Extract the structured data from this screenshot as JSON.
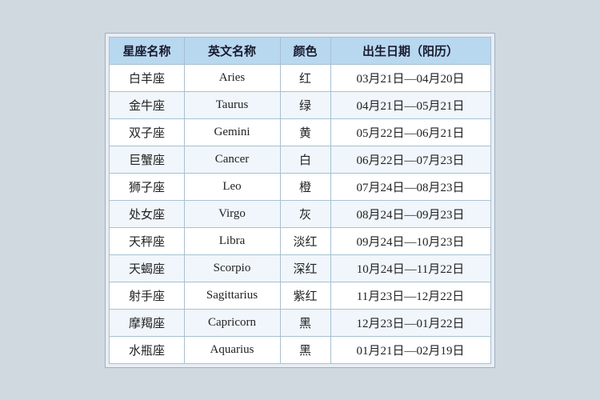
{
  "header": {
    "col1": "星座名称",
    "col2": "英文名称",
    "col3": "颜色",
    "col4": "出生日期（阳历）"
  },
  "rows": [
    {
      "chinese": "白羊座",
      "english": "Aries",
      "color": "红",
      "date": "03月21日—04月20日"
    },
    {
      "chinese": "金牛座",
      "english": "Taurus",
      "color": "绿",
      "date": "04月21日—05月21日"
    },
    {
      "chinese": "双子座",
      "english": "Gemini",
      "color": "黄",
      "date": "05月22日—06月21日"
    },
    {
      "chinese": "巨蟹座",
      "english": "Cancer",
      "color": "白",
      "date": "06月22日—07月23日"
    },
    {
      "chinese": "狮子座",
      "english": "Leo",
      "color": "橙",
      "date": "07月24日—08月23日"
    },
    {
      "chinese": "处女座",
      "english": "Virgo",
      "color": "灰",
      "date": "08月24日—09月23日"
    },
    {
      "chinese": "天秤座",
      "english": "Libra",
      "color": "淡红",
      "date": "09月24日—10月23日"
    },
    {
      "chinese": "天蝎座",
      "english": "Scorpio",
      "color": "深红",
      "date": "10月24日—11月22日"
    },
    {
      "chinese": "射手座",
      "english": "Sagittarius",
      "color": "紫红",
      "date": "11月23日—12月22日"
    },
    {
      "chinese": "摩羯座",
      "english": "Capricorn",
      "color": "黑",
      "date": "12月23日—01月22日"
    },
    {
      "chinese": "水瓶座",
      "english": "Aquarius",
      "color": "黑",
      "date": "01月21日—02月19日"
    }
  ]
}
